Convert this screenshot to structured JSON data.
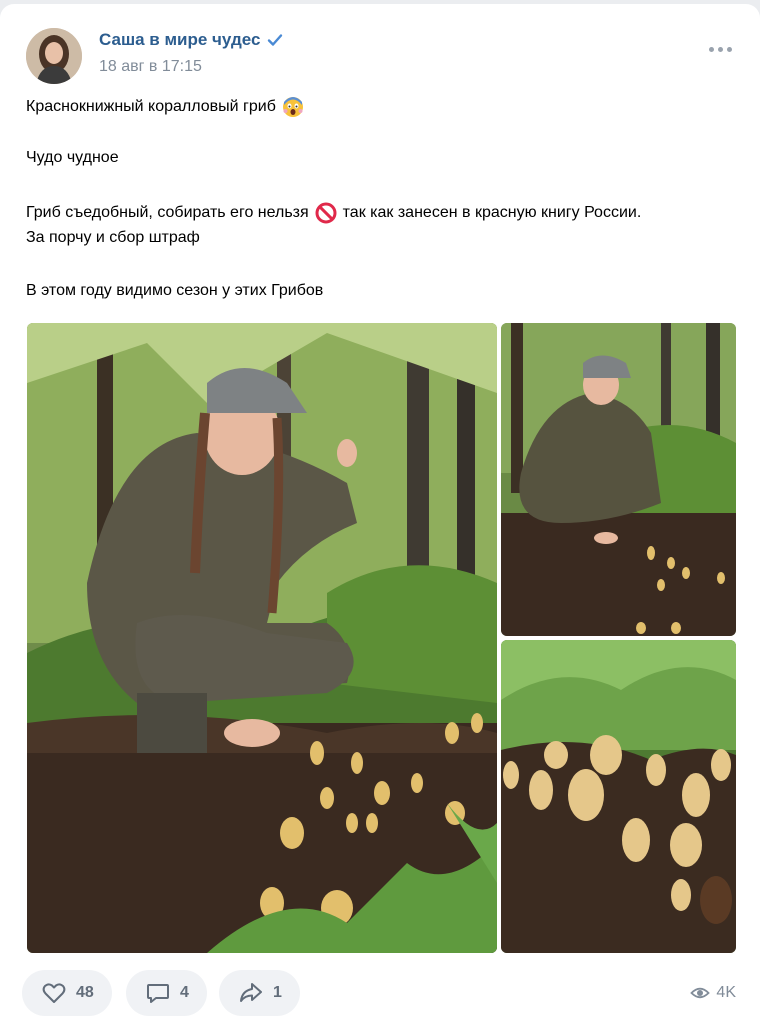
{
  "post": {
    "author": "Саша в мире чудес",
    "date": "18 авг в 17:15",
    "verified": true,
    "lines": {
      "l1": "Краснокнижный коралловый гриб",
      "l2": "Чудо чудное",
      "l3a": "Гриб съедобный, собирать его нельзя",
      "l3b": "так как занесен в красную книгу России.",
      "l4": "За порчу и сбор штраф",
      "l5": "В этом году видимо сезон у этих Грибов"
    },
    "emoji": {
      "l1": "screaming-face",
      "l3": "no-entry-sign"
    }
  },
  "photos": [
    {
      "name": "photo-woman-crouching-near-coral-mushrooms"
    },
    {
      "name": "photo-woman-crouching-wide"
    },
    {
      "name": "photo-coral-mushrooms-closeup"
    }
  ],
  "actions": {
    "likes": "48",
    "comments": "4",
    "shares": "1",
    "views": "4K"
  },
  "colors": {
    "author": "#2c5d8f",
    "meta": "#818c99",
    "action_bg": "#f0f2f5",
    "action_text": "#626d7a",
    "verified": "#4a8ad4"
  },
  "icons": [
    "avatar",
    "verified-icon",
    "more-icon",
    "heart-icon",
    "comment-icon",
    "share-icon",
    "eye-icon"
  ]
}
